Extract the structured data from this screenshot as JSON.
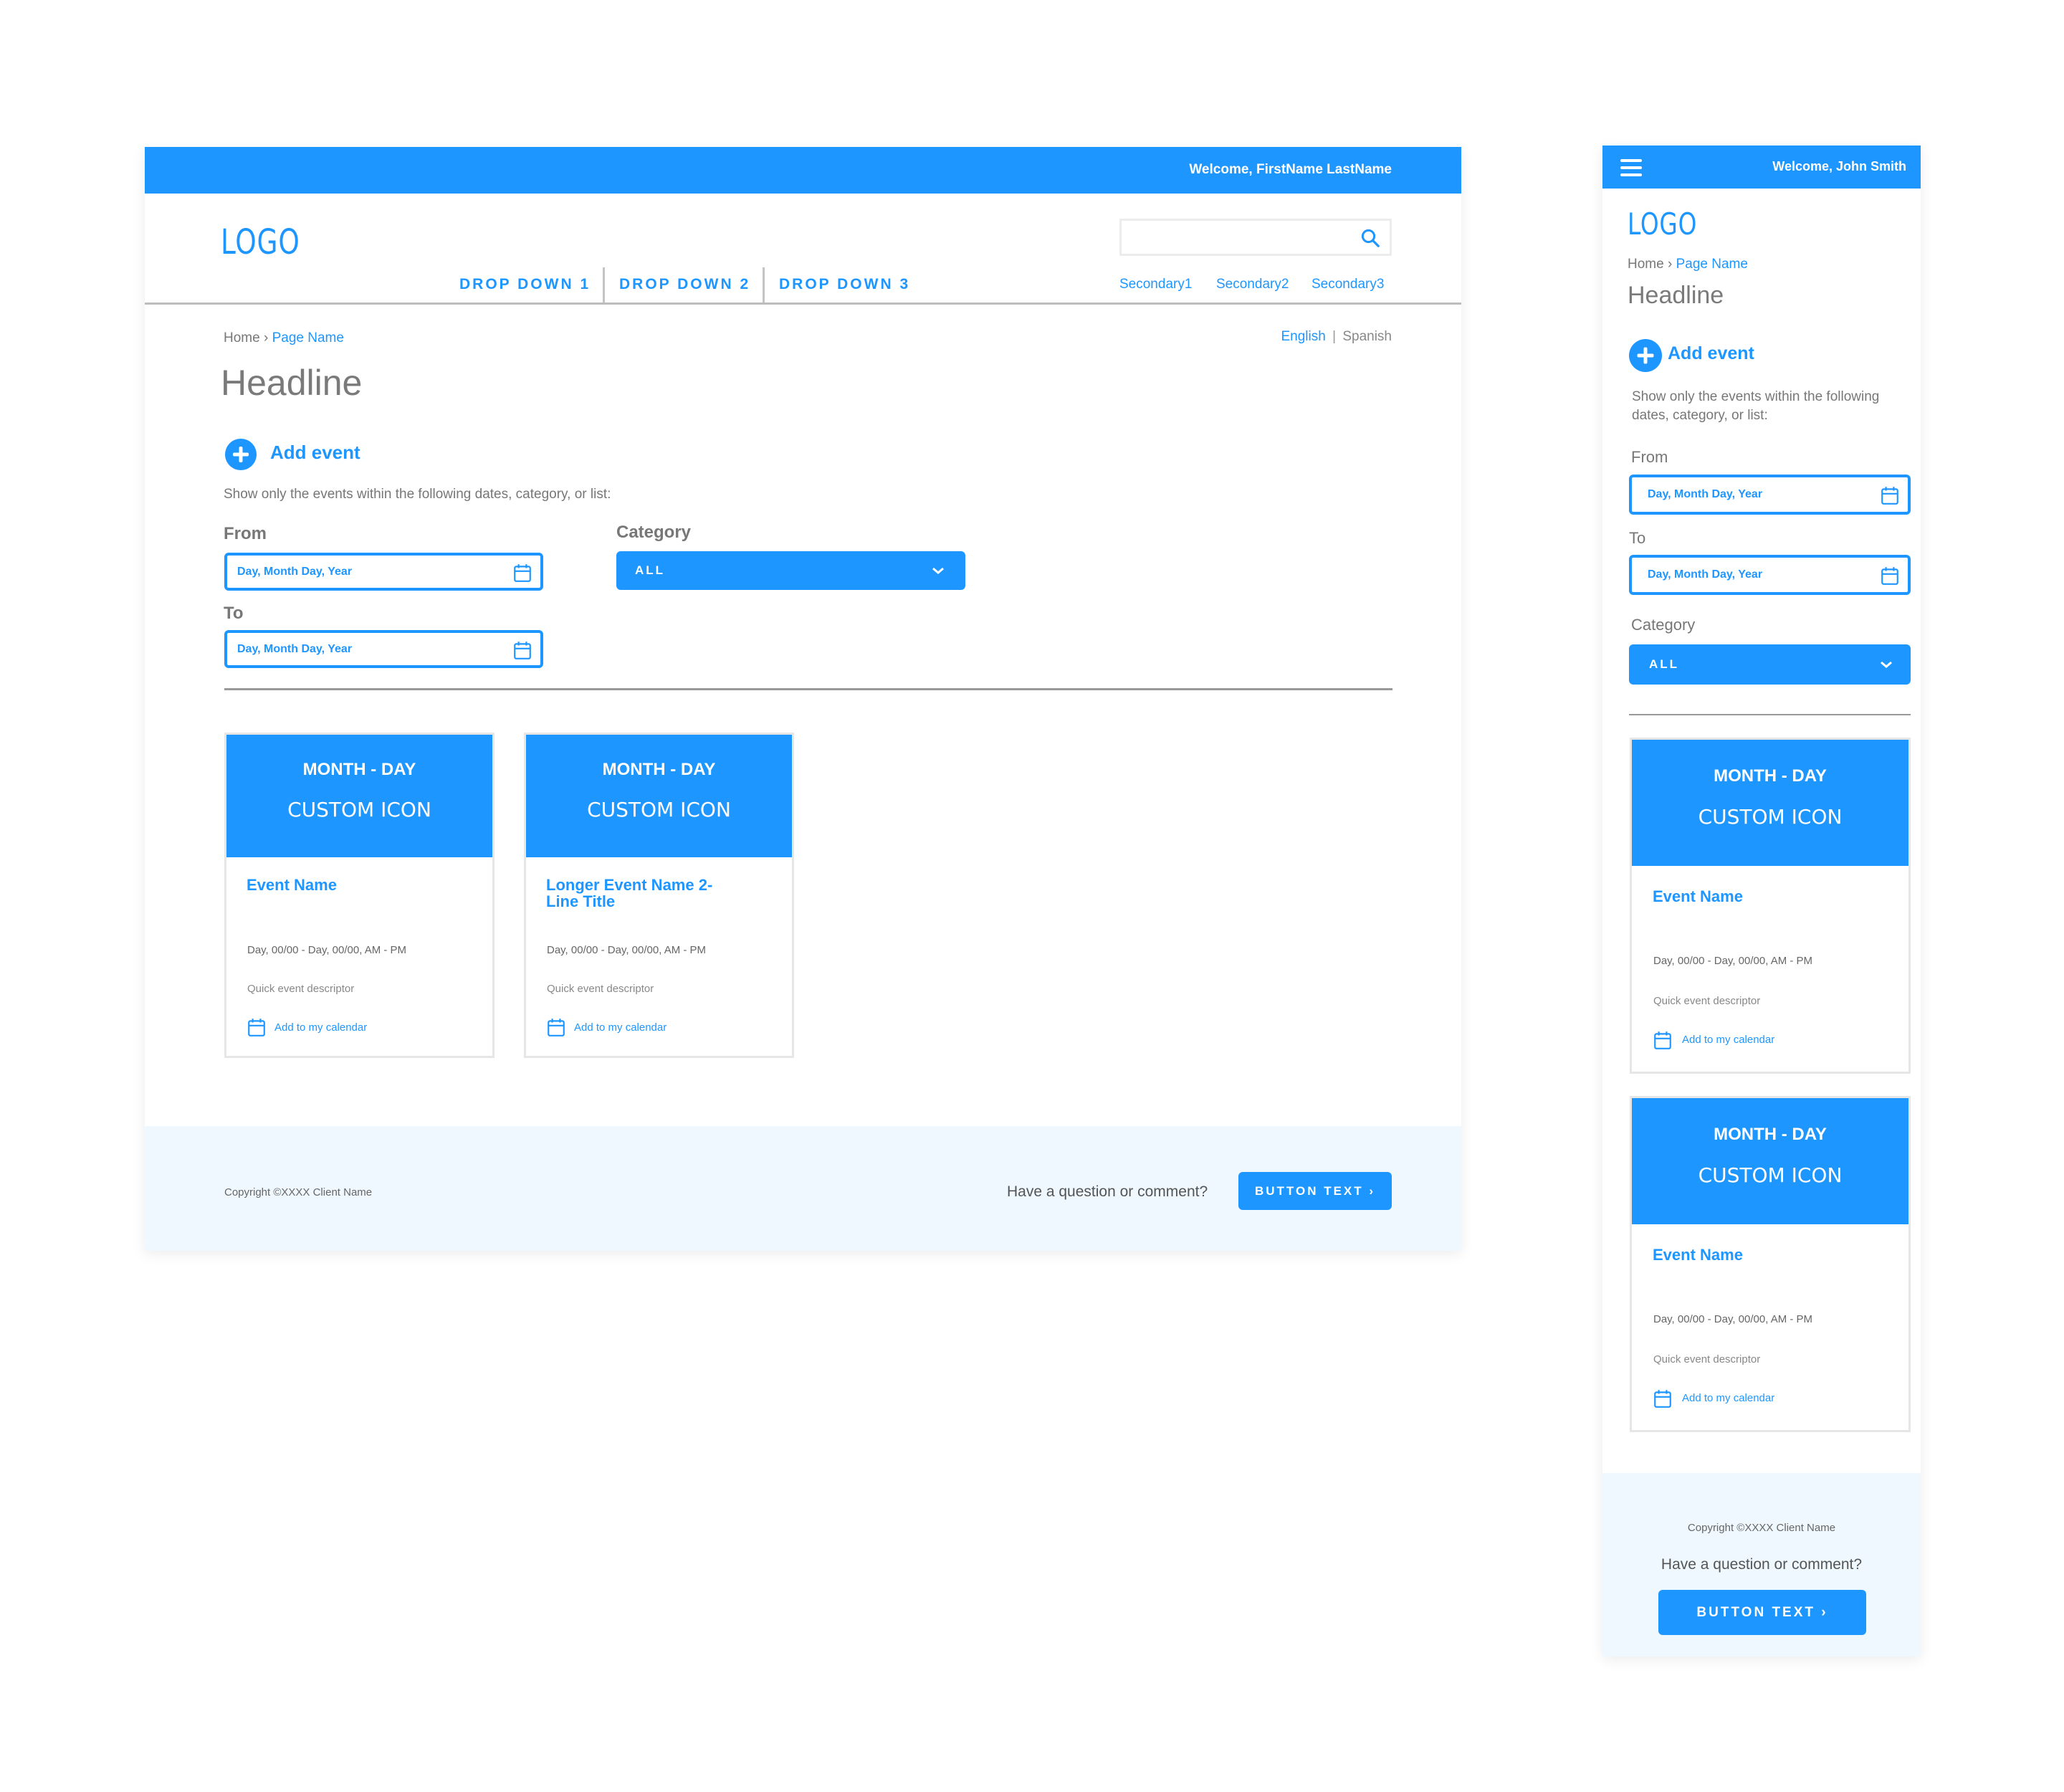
{
  "colors": {
    "accent": "#1E96FF",
    "footer_bg": "#EEF8FE",
    "text_gray": "#777777"
  },
  "desktop": {
    "welcome": "Welcome, FirstName LastName",
    "logo": "LOGO",
    "search": {
      "placeholder": "",
      "icon": "search-icon"
    },
    "nav": [
      "DROP DOWN 1",
      "DROP DOWN 2",
      "DROP DOWN 3"
    ],
    "secondary": [
      "Secondary1",
      "Secondary2",
      "Secondary3"
    ],
    "breadcrumb": {
      "home": "Home",
      "separator": "›",
      "current": "Page Name"
    },
    "languages": {
      "active": "English",
      "separator": "|",
      "other": "Spanish"
    },
    "headline": "Headline",
    "add_event": "Add event",
    "filter_description": "Show only the events within the following dates, category, or list:",
    "from_label": "From",
    "from_value": "Day, Month Day, Year",
    "to_label": "To",
    "to_value": "Day, Month Day, Year",
    "category_label": "Category",
    "category_value": "ALL",
    "cards": [
      {
        "date": "MONTH  - DAY",
        "icon": "CUSTOM ICON",
        "title": "Event Name",
        "time": "Day, 00/00 - Day, 00/00, AM - PM",
        "descriptor": "Quick event descriptor",
        "calendar": "Add to my calendar"
      },
      {
        "date": "MONTH  - DAY",
        "icon": "CUSTOM ICON",
        "title": "Longer Event Name 2-Line Title",
        "time": "Day, 00/00 - Day, 00/00, AM - PM",
        "descriptor": "Quick event descriptor",
        "calendar": "Add to my calendar"
      }
    ],
    "footer": {
      "copyright": "Copyright ©XXXX Client Name",
      "question": "Have a question or comment?",
      "button": "BUTTON TEXT ›"
    }
  },
  "mobile": {
    "welcome": "Welcome, John Smith",
    "logo": "LOGO",
    "breadcrumb": {
      "home": "Home",
      "separator": "›",
      "current": "Page Name"
    },
    "headline": "Headline",
    "add_event": "Add event",
    "filter_description_1": "Show only the events within the following",
    "filter_description_2": "dates, category, or list:",
    "from_label": "From",
    "from_value": "Day, Month Day, Year",
    "to_label": "To",
    "to_value": "Day, Month Day, Year",
    "category_label": "Category",
    "category_value": "ALL",
    "cards": [
      {
        "date": "MONTH  - DAY",
        "icon": "CUSTOM ICON",
        "title": "Event Name",
        "time": "Day, 00/00 - Day, 00/00, AM - PM",
        "descriptor": "Quick event descriptor",
        "calendar": "Add to my calendar"
      },
      {
        "date": "MONTH  - DAY",
        "icon": "CUSTOM ICON",
        "title": "Event Name",
        "time": "Day, 00/00 - Day, 00/00, AM - PM",
        "descriptor": "Quick event descriptor",
        "calendar": "Add to my calendar"
      }
    ],
    "footer": {
      "copyright": "Copyright ©XXXX Client Name",
      "question": "Have a question or comment?",
      "button": "BUTTON TEXT ›"
    }
  }
}
